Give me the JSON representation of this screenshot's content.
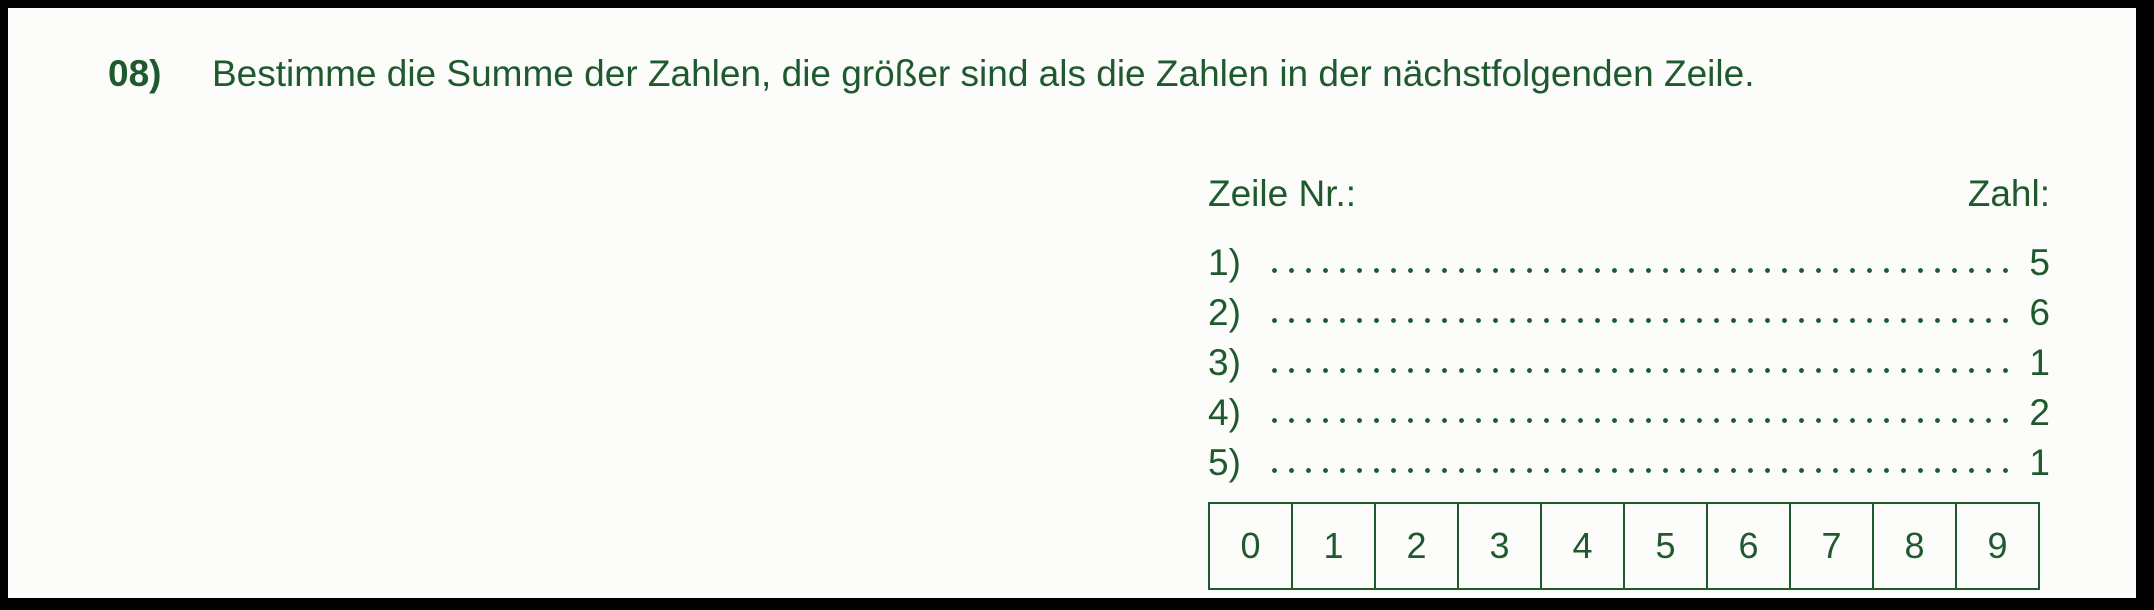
{
  "question": {
    "number": "08)",
    "text": "Bestimme die Summe der Zahlen, die größer sind als die Zahlen in der nächstfolgenden Zeile."
  },
  "table": {
    "header_left": "Zeile Nr.:",
    "header_right": "Zahl:",
    "rows": [
      {
        "label": "1)",
        "value": "5"
      },
      {
        "label": "2)",
        "value": "6"
      },
      {
        "label": "3)",
        "value": "1"
      },
      {
        "label": "4)",
        "value": "2"
      },
      {
        "label": "5)",
        "value": "1"
      }
    ]
  },
  "answer_options": [
    "0",
    "1",
    "2",
    "3",
    "4",
    "5",
    "6",
    "7",
    "8",
    "9"
  ],
  "colors": {
    "ink": "#1e5a2e",
    "paper": "#fcfcfa",
    "frame": "#000000"
  }
}
